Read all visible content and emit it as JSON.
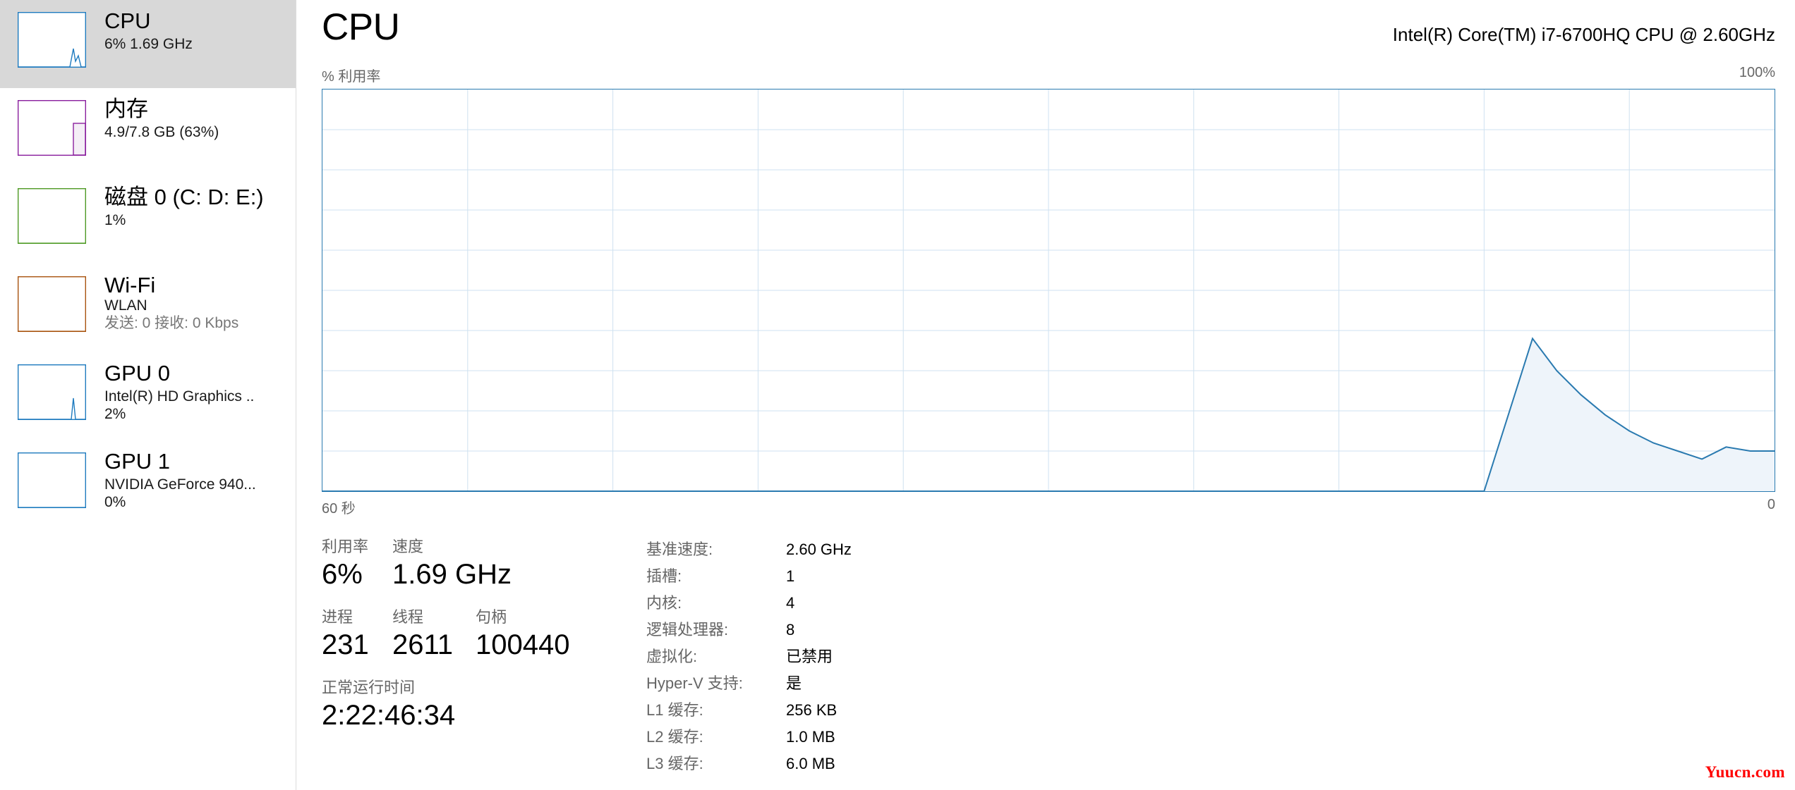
{
  "sidebar": {
    "items": [
      {
        "name": "cpu",
        "title": "CPU",
        "sub": "6%  1.69 GHz",
        "sub2": "",
        "sub3": "",
        "accent": "#1f7bbf",
        "selected": true,
        "thumb_kind": "line-spike"
      },
      {
        "name": "memory",
        "title": "内存",
        "sub": "4.9/7.8 GB (63%)",
        "sub2": "",
        "sub3": "",
        "accent": "#8a1f9e",
        "selected": false,
        "thumb_kind": "memory-bar"
      },
      {
        "name": "disk-0",
        "title": "磁盘 0 (C: D: E:)",
        "sub": "1%",
        "sub2": "",
        "sub3": "",
        "accent": "#4e9a24",
        "selected": false,
        "thumb_kind": "flat"
      },
      {
        "name": "wifi",
        "title": "Wi-Fi",
        "sub": "WLAN",
        "sub2": "发送: 0 接收: 0 Kbps",
        "sub3": "",
        "accent": "#a8530f",
        "selected": false,
        "thumb_kind": "flat"
      },
      {
        "name": "gpu-0",
        "title": "GPU 0",
        "sub": "Intel(R) HD Graphics ..",
        "sub2": "2%",
        "sub3": "",
        "accent": "#1f7bbf",
        "selected": false,
        "thumb_kind": "thin-spike"
      },
      {
        "name": "gpu-1",
        "title": "GPU 1",
        "sub": "NVIDIA GeForce 940...",
        "sub2": "0%",
        "sub3": "",
        "accent": "#1f7bbf",
        "selected": false,
        "thumb_kind": "flat"
      }
    ]
  },
  "main": {
    "title": "CPU",
    "cpu_model": "Intel(R) Core(TM) i7-6700HQ CPU @ 2.60GHz"
  },
  "chart_labels": {
    "top_left": "% 利用率",
    "top_right": "100%",
    "bottom_left": "60 秒",
    "bottom_right": "0"
  },
  "chart_data": {
    "type": "area",
    "title": "% 利用率",
    "xlabel": "60 秒",
    "ylabel": "% 利用率",
    "ylim": [
      0,
      100
    ],
    "xlim": [
      0,
      60
    ],
    "grid": true,
    "legend": "none",
    "line_color": "#2a7ab0",
    "fill_color": "#eef4fa",
    "x_tick_labels": [
      "60 秒",
      "0"
    ],
    "y_tick_labels": [
      "100%",
      "0"
    ],
    "x": [
      0,
      44,
      48,
      50,
      51,
      52,
      53,
      54,
      55,
      56,
      57,
      58,
      59,
      60
    ],
    "values": [
      0,
      0,
      0,
      38,
      30,
      24,
      19,
      15,
      12,
      10,
      8,
      11,
      10,
      10
    ]
  },
  "stats": {
    "utilization_label": "利用率",
    "utilization_value": "6%",
    "speed_label": "速度",
    "speed_value": "1.69 GHz",
    "processes_label": "进程",
    "processes_value": "231",
    "threads_label": "线程",
    "threads_value": "2611",
    "handles_label": "句柄",
    "handles_value": "100440",
    "uptime_label": "正常运行时间",
    "uptime_value": "2:22:46:34"
  },
  "specs": [
    {
      "key": "基准速度:",
      "value": "2.60 GHz"
    },
    {
      "key": "插槽:",
      "value": "1"
    },
    {
      "key": "内核:",
      "value": "4"
    },
    {
      "key": "逻辑处理器:",
      "value": "8"
    },
    {
      "key": "虚拟化:",
      "value": "已禁用"
    },
    {
      "key": "Hyper-V 支持:",
      "value": "是"
    },
    {
      "key": "L1 缓存:",
      "value": "256 KB"
    },
    {
      "key": "L2 缓存:",
      "value": "1.0 MB"
    },
    {
      "key": "L3 缓存:",
      "value": "6.0 MB"
    }
  ],
  "watermark": "Yuucn.com"
}
